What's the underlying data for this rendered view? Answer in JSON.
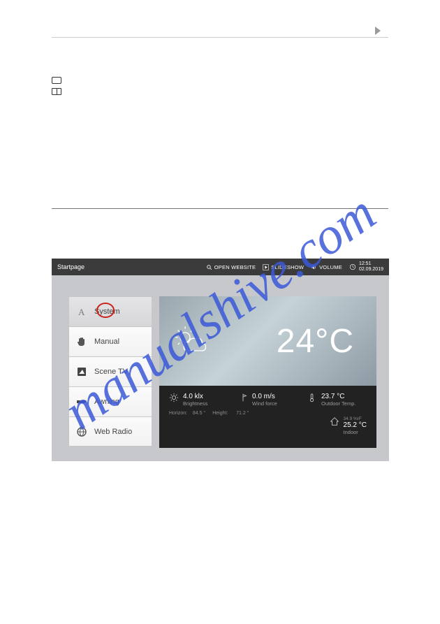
{
  "watermark": "manualshive.com",
  "device": {
    "titlebar": {
      "title": "Startpage",
      "open_website": "OPEN WEBSITE",
      "slideshow": "SLIDESHOW",
      "volume": "VOLUME",
      "time": "12:51",
      "date": "02.09.2019"
    },
    "nav": [
      {
        "label": "System"
      },
      {
        "label": "Manual"
      },
      {
        "label": "Scene TV"
      },
      {
        "label": "Awning"
      },
      {
        "label": "Web Radio"
      }
    ],
    "weather": {
      "main_temp": "24°C",
      "brightness": {
        "value": "4.0 klx",
        "label": "Brightness"
      },
      "wind": {
        "value": "0.0 m/s",
        "label": "Wind force"
      },
      "outdoor": {
        "value": "23.7 °C",
        "label": "Outdoor Temp."
      },
      "horizon": {
        "label": "Horizon:",
        "value": "84.5 °"
      },
      "height": {
        "label": "Height:",
        "value": "71.2 °"
      },
      "indoor": {
        "small": "34.9 %rF",
        "value": "25.2 °C",
        "label": "Indoor"
      }
    }
  }
}
